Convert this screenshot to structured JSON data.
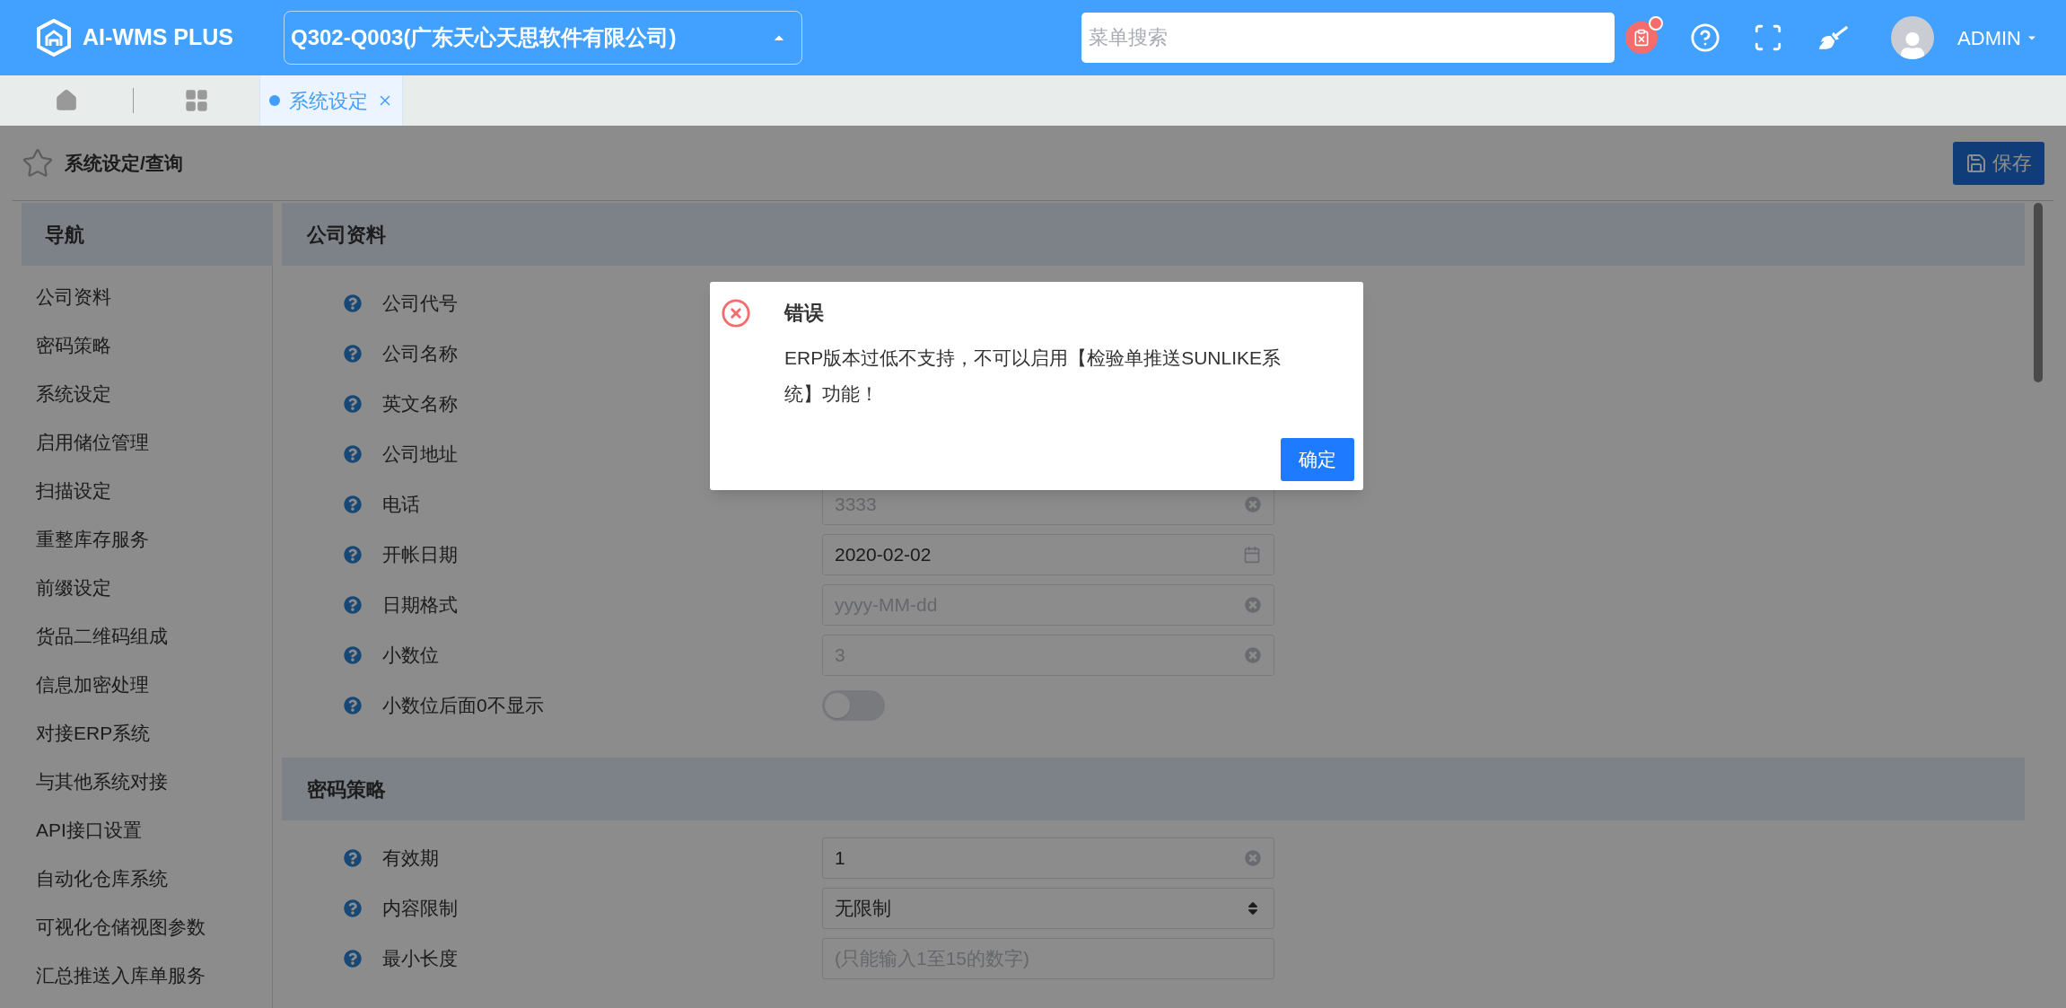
{
  "header": {
    "app_name": "AI-WMS PLUS",
    "company": "Q302-Q003(广东天心天思软件有限公司)",
    "search": {
      "placeholder": "菜单搜索"
    },
    "notification_dot": true,
    "user": "ADMIN"
  },
  "tabs": [
    {
      "label": "系统设定",
      "selected": true
    }
  ],
  "page": {
    "breadcrumb": "系统设定/查询",
    "save_button": "保存"
  },
  "nav": {
    "title": "导航",
    "items": [
      "公司资料",
      "密码策略",
      "系统设定",
      "启用储位管理",
      "扫描设定",
      "重整库存服务",
      "前缀设定",
      "货品二维码组成",
      "信息加密处理",
      "对接ERP系统",
      "与其他系统对接",
      "API接口设置",
      "自动化仓库系统",
      "可视化仓储视图参数",
      "汇总推送入库单服务"
    ]
  },
  "sections": [
    {
      "title": "公司资料",
      "rows": [
        {
          "label": "公司代号"
        },
        {
          "label": "公司名称"
        },
        {
          "label": "英文名称"
        },
        {
          "label": "公司地址"
        },
        {
          "label": "电话",
          "field": {
            "kind": "input",
            "placeholder": "3333"
          }
        },
        {
          "label": "开帐日期",
          "field": {
            "kind": "date",
            "value": "2020-02-02"
          }
        },
        {
          "label": "日期格式",
          "field": {
            "kind": "input",
            "placeholder": "yyyy-MM-dd"
          }
        },
        {
          "label": "小数位",
          "field": {
            "kind": "input",
            "placeholder": "3"
          }
        },
        {
          "label": "小数位后面0不显示",
          "field": {
            "kind": "switch",
            "on": false
          }
        }
      ]
    },
    {
      "title": "密码策略",
      "rows": [
        {
          "label": "有效期",
          "field": {
            "kind": "input",
            "value": "1"
          }
        },
        {
          "label": "内容限制",
          "field": {
            "kind": "select",
            "value": "无限制"
          }
        },
        {
          "label": "最小长度",
          "field": {
            "kind": "plain",
            "placeholder": "(只能输入1至15的数字)"
          }
        }
      ]
    }
  ],
  "dialog": {
    "title": "错误",
    "message": "ERP版本过低不支持，不可以启用【检验单推送SUNLIKE系统】功能！",
    "ok_button": "确定"
  }
}
